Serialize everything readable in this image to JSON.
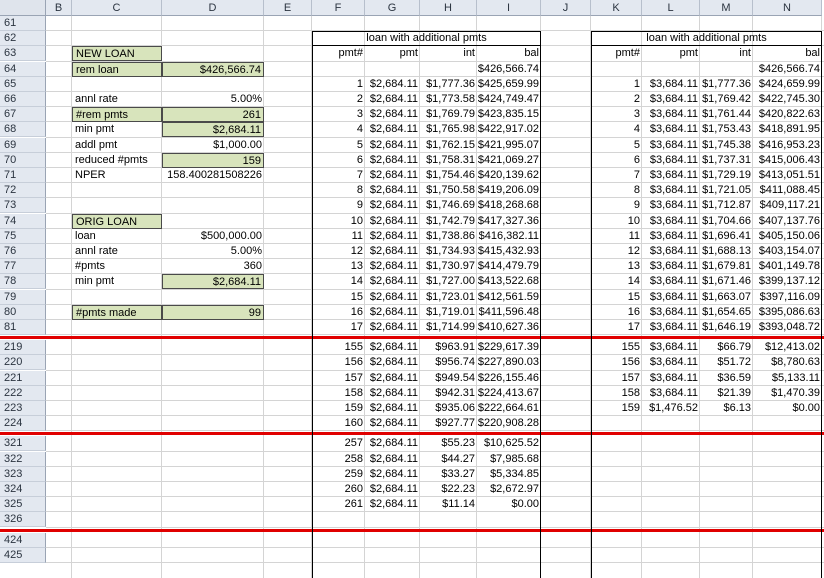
{
  "columns": [
    "B",
    "C",
    "D",
    "E",
    "F",
    "G",
    "H",
    "I",
    "J",
    "K",
    "L",
    "M",
    "N"
  ],
  "rows": [
    "61",
    "62",
    "63",
    "64",
    "65",
    "66",
    "67",
    "68",
    "69",
    "70",
    "71",
    "72",
    "73",
    "74",
    "75",
    "76",
    "77",
    "78",
    "79",
    "80",
    "81",
    "219",
    "220",
    "221",
    "222",
    "223",
    "224",
    "321",
    "322",
    "323",
    "324",
    "325",
    "326",
    "424",
    "425"
  ],
  "new_loan": {
    "title": "NEW LOAN",
    "rem_loan_label": "rem loan",
    "rem_loan_value": "$426,566.74",
    "annl_rate_label": "annl rate",
    "annl_rate_value": "5.00%",
    "rem_pmts_label": "#rem pmts",
    "rem_pmts_value": "261",
    "min_pmt_label": "min pmt",
    "min_pmt_value": "$2,684.11",
    "addl_pmt_label": "addl pmt",
    "addl_pmt_value": "$1,000.00",
    "reduced_pmts_label": "reduced #pmts",
    "reduced_pmts_value": "159",
    "nper_label": "NPER",
    "nper_value": "158.400281508226"
  },
  "orig_loan": {
    "title": "ORIG LOAN",
    "loan_label": "loan",
    "loan_value": "$500,000.00",
    "annl_rate_label": "annl rate",
    "annl_rate_value": "5.00%",
    "pmts_label": "#pmts",
    "pmts_value": "360",
    "min_pmt_label": "min pmt",
    "min_pmt_value": "$2,684.11",
    "pmts_made_label": "#pmts made",
    "pmts_made_value": "99"
  },
  "table1": {
    "title": "loan with additional pmts",
    "headers": [
      "pmt#",
      "pmt",
      "int",
      "bal"
    ],
    "rows": [
      [
        "",
        "",
        "",
        "$426,566.74"
      ],
      [
        "1",
        "$2,684.11",
        "$1,777.36",
        "$425,659.99"
      ],
      [
        "2",
        "$2,684.11",
        "$1,773.58",
        "$424,749.47"
      ],
      [
        "3",
        "$2,684.11",
        "$1,769.79",
        "$423,835.15"
      ],
      [
        "4",
        "$2,684.11",
        "$1,765.98",
        "$422,917.02"
      ],
      [
        "5",
        "$2,684.11",
        "$1,762.15",
        "$421,995.07"
      ],
      [
        "6",
        "$2,684.11",
        "$1,758.31",
        "$421,069.27"
      ],
      [
        "7",
        "$2,684.11",
        "$1,754.46",
        "$420,139.62"
      ],
      [
        "8",
        "$2,684.11",
        "$1,750.58",
        "$419,206.09"
      ],
      [
        "9",
        "$2,684.11",
        "$1,746.69",
        "$418,268.68"
      ],
      [
        "10",
        "$2,684.11",
        "$1,742.79",
        "$417,327.36"
      ],
      [
        "11",
        "$2,684.11",
        "$1,738.86",
        "$416,382.11"
      ],
      [
        "12",
        "$2,684.11",
        "$1,734.93",
        "$415,432.93"
      ],
      [
        "13",
        "$2,684.11",
        "$1,730.97",
        "$414,479.79"
      ],
      [
        "14",
        "$2,684.11",
        "$1,727.00",
        "$413,522.68"
      ],
      [
        "15",
        "$2,684.11",
        "$1,723.01",
        "$412,561.59"
      ],
      [
        "16",
        "$2,684.11",
        "$1,719.01",
        "$411,596.48"
      ],
      [
        "17",
        "$2,684.11",
        "$1,714.99",
        "$410,627.36"
      ],
      [
        "155",
        "$2,684.11",
        "$963.91",
        "$229,617.39"
      ],
      [
        "156",
        "$2,684.11",
        "$956.74",
        "$227,890.03"
      ],
      [
        "157",
        "$2,684.11",
        "$949.54",
        "$226,155.46"
      ],
      [
        "158",
        "$2,684.11",
        "$942.31",
        "$224,413.67"
      ],
      [
        "159",
        "$2,684.11",
        "$935.06",
        "$222,664.61"
      ],
      [
        "160",
        "$2,684.11",
        "$927.77",
        "$220,908.28"
      ],
      [
        "257",
        "$2,684.11",
        "$55.23",
        "$10,625.52"
      ],
      [
        "258",
        "$2,684.11",
        "$44.27",
        "$7,985.68"
      ],
      [
        "259",
        "$2,684.11",
        "$33.27",
        "$5,334.85"
      ],
      [
        "260",
        "$2,684.11",
        "$22.23",
        "$2,672.97"
      ],
      [
        "261",
        "$2,684.11",
        "$11.14",
        "$0.00"
      ]
    ]
  },
  "table2": {
    "title": "loan with additional pmts",
    "headers": [
      "pmt#",
      "pmt",
      "int",
      "bal"
    ],
    "rows": [
      [
        "",
        "",
        "",
        "$426,566.74"
      ],
      [
        "1",
        "$3,684.11",
        "$1,777.36",
        "$424,659.99"
      ],
      [
        "2",
        "$3,684.11",
        "$1,769.42",
        "$422,745.30"
      ],
      [
        "3",
        "$3,684.11",
        "$1,761.44",
        "$420,822.63"
      ],
      [
        "4",
        "$3,684.11",
        "$1,753.43",
        "$418,891.95"
      ],
      [
        "5",
        "$3,684.11",
        "$1,745.38",
        "$416,953.23"
      ],
      [
        "6",
        "$3,684.11",
        "$1,737.31",
        "$415,006.43"
      ],
      [
        "7",
        "$3,684.11",
        "$1,729.19",
        "$413,051.51"
      ],
      [
        "8",
        "$3,684.11",
        "$1,721.05",
        "$411,088.45"
      ],
      [
        "9",
        "$3,684.11",
        "$1,712.87",
        "$409,117.21"
      ],
      [
        "10",
        "$3,684.11",
        "$1,704.66",
        "$407,137.76"
      ],
      [
        "11",
        "$3,684.11",
        "$1,696.41",
        "$405,150.06"
      ],
      [
        "12",
        "$3,684.11",
        "$1,688.13",
        "$403,154.07"
      ],
      [
        "13",
        "$3,684.11",
        "$1,679.81",
        "$401,149.78"
      ],
      [
        "14",
        "$3,684.11",
        "$1,671.46",
        "$399,137.12"
      ],
      [
        "15",
        "$3,684.11",
        "$1,663.07",
        "$397,116.09"
      ],
      [
        "16",
        "$3,684.11",
        "$1,654.65",
        "$395,086.63"
      ],
      [
        "17",
        "$3,684.11",
        "$1,646.19",
        "$393,048.72"
      ],
      [
        "155",
        "$3,684.11",
        "$66.79",
        "$12,413.02"
      ],
      [
        "156",
        "$3,684.11",
        "$51.72",
        "$8,780.63"
      ],
      [
        "157",
        "$3,684.11",
        "$36.59",
        "$5,133.11"
      ],
      [
        "158",
        "$3,684.11",
        "$21.39",
        "$1,470.39"
      ],
      [
        "159",
        "$1,476.52",
        "$6.13",
        "$0.00"
      ]
    ]
  }
}
